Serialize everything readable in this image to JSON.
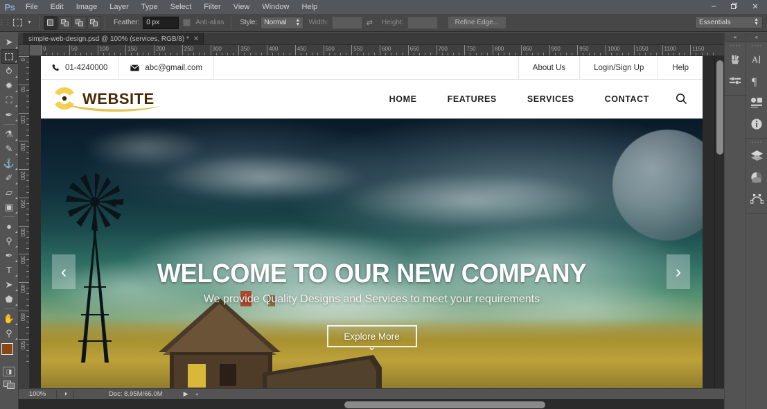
{
  "app": {
    "name": "Ps",
    "menus": [
      "File",
      "Edit",
      "Image",
      "Layer",
      "Type",
      "Select",
      "Filter",
      "View",
      "Window",
      "Help"
    ],
    "window_buttons": {
      "minimize": "–",
      "restore": "❐",
      "close": "✕"
    }
  },
  "options_bar": {
    "tool": "rectangular-marquee",
    "feather_label": "Feather:",
    "feather_value": "0 px",
    "antialias_label": "Anti-alias",
    "style_label": "Style:",
    "style_value": "Normal",
    "width_label": "Width:",
    "width_value": "",
    "height_label": "Height:",
    "height_value": "",
    "refine_edge_label": "Refine Edge...",
    "workspace": "Essentials"
  },
  "toolbar": {
    "tools": [
      {
        "name": "move-tool",
        "glyph": "➤",
        "active": false
      },
      {
        "name": "rectangular-marquee-tool",
        "glyph": "",
        "active": true
      },
      {
        "name": "lasso-tool",
        "glyph": "⥁",
        "active": false
      },
      {
        "name": "magic-wand-tool",
        "glyph": "✹",
        "active": false
      },
      {
        "name": "crop-tool",
        "glyph": "⛶",
        "active": false
      },
      {
        "name": "eyedropper-tool",
        "glyph": "✒",
        "active": false
      },
      {
        "name": "spot-healing-brush-tool",
        "glyph": "⚗",
        "active": false
      },
      {
        "name": "brush-tool",
        "glyph": "✎",
        "active": false
      },
      {
        "name": "clone-stamp-tool",
        "glyph": "⚓",
        "active": false
      },
      {
        "name": "history-brush-tool",
        "glyph": "✐",
        "active": false
      },
      {
        "name": "eraser-tool",
        "glyph": "▱",
        "active": false
      },
      {
        "name": "gradient-tool",
        "glyph": "▣",
        "active": false
      },
      {
        "name": "blur-tool",
        "glyph": "●",
        "active": false
      },
      {
        "name": "dodge-tool",
        "glyph": "⚲",
        "active": false
      },
      {
        "name": "pen-tool",
        "glyph": "✒",
        "active": false
      },
      {
        "name": "horizontal-type-tool",
        "glyph": "T",
        "active": false
      },
      {
        "name": "path-selection-tool",
        "glyph": "➤",
        "active": false
      },
      {
        "name": "custom-shape-tool",
        "glyph": "⬟",
        "active": false
      },
      {
        "name": "hand-tool",
        "glyph": "✋",
        "active": false
      },
      {
        "name": "zoom-tool",
        "glyph": "⚲",
        "active": false
      }
    ],
    "foreground_color": "#8b4513",
    "background_color": "#283b5b",
    "quick_mask_name": "quick-mask-toggle",
    "screen_mode_name": "screen-mode-toggle"
  },
  "document": {
    "tab_title": "simple-web-design.psd @ 100% (services, RGB/8) *",
    "close_label": "✕",
    "zoom_level": "100%",
    "doc_size": "Doc: 8.95M/66.0M",
    "ruler_h_labels": [
      0,
      50,
      100,
      150,
      200,
      250,
      300,
      350,
      400,
      450,
      500,
      550,
      600,
      650,
      700,
      750,
      800,
      850,
      900,
      950,
      1000,
      1050,
      1100,
      1150
    ],
    "ruler_v_labels": [
      0,
      50,
      100,
      150,
      200,
      250,
      300,
      350,
      400,
      450,
      500
    ]
  },
  "website": {
    "topbar": {
      "phone": "01-4240000",
      "email": "abc@gmail.com",
      "links": [
        "About Us",
        "Login/Sign Up",
        "Help"
      ]
    },
    "brand": {
      "text": "WEBSITE",
      "logo_color": "#f0c93f",
      "text_color": "#4a2a06"
    },
    "nav": [
      "HOME",
      "FEATURES",
      "SERVICES",
      "CONTACT"
    ],
    "search_icon": "search-icon",
    "hero": {
      "title": "WELCOME TO OUR NEW COMPANY",
      "subtitle": "We provide Quality Designs and Services to meet your requirements",
      "cta": "Explore More",
      "prev_arrow": "‹",
      "next_arrow": "›",
      "chevron": "⌄"
    }
  },
  "panels": {
    "left_column": [
      {
        "name": "color-panel-icon",
        "glyph": "🎨"
      },
      {
        "name": "swatches-panel-icon",
        "glyph": "☰"
      }
    ],
    "right_column_group1": [
      {
        "name": "character-panel-icon",
        "glyph": "A"
      },
      {
        "name": "paragraph-panel-icon",
        "glyph": "¶"
      },
      {
        "name": "styles-panel-icon",
        "glyph": "▥"
      },
      {
        "name": "info-panel-icon",
        "glyph": "i"
      }
    ],
    "right_column_group2": [
      {
        "name": "layers-panel-icon",
        "glyph": "◆"
      },
      {
        "name": "adjustments-panel-icon",
        "glyph": "◑"
      },
      {
        "name": "paths-panel-icon",
        "glyph": "⟁"
      }
    ],
    "collapse_glyph": "«"
  }
}
